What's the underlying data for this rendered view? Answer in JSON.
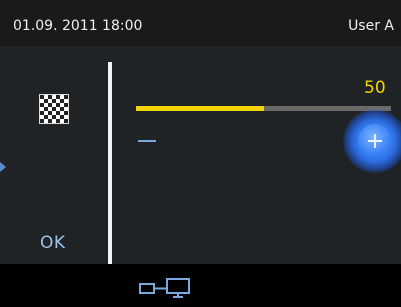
{
  "statusbar": {
    "datetime": "01.09. 2011 18:00",
    "user": "User A"
  },
  "left_panel": {
    "ok_label": "OK",
    "mode_icon": "checkerboard-icon"
  },
  "slider": {
    "value_text": "50",
    "level_fraction": 0.5,
    "minus_icon": "minus-icon",
    "plus_icon": "plus-icon"
  },
  "footer": {
    "network_icon": "network-devices-icon"
  },
  "colors": {
    "accent_yellow": "#f3d300",
    "accent_blue": "#3b82f4",
    "label_blue": "#9fc0ea"
  }
}
